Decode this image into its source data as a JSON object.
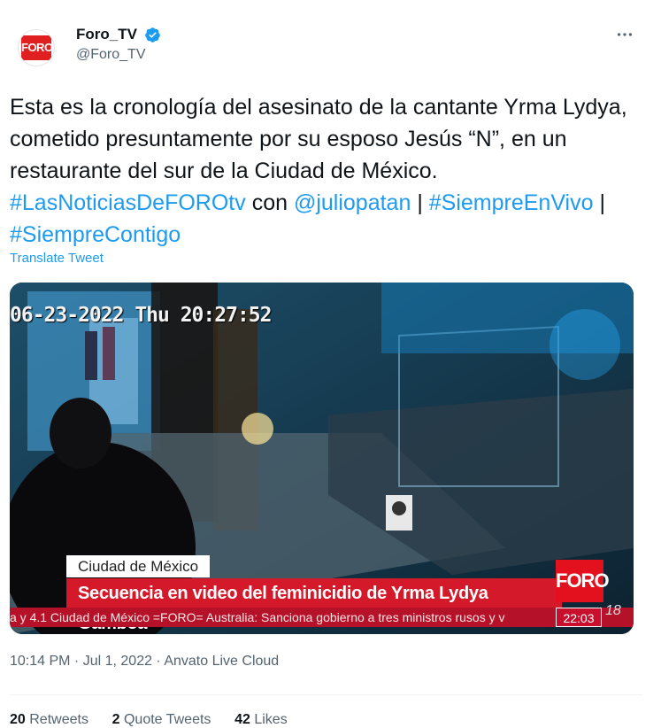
{
  "author": {
    "display_name": "Foro_TV",
    "handle": "@Foro_TV",
    "avatar_text": "FORO",
    "verified": true
  },
  "more_icon": "more-horizontal-icon",
  "tweet": {
    "text_plain_1": "Esta es la cronología del asesinato de la cantante Yrma Lydya, cometido presuntamente por su esposo Jesús “N”, en un restaurante del sur de la Ciudad de México. ",
    "hashtag_1": "#LasNoticiasDeFOROtv",
    "text_plain_2": " con ",
    "mention_1": "@juliopatan",
    "sep_1": " | ",
    "hashtag_2": "#SiempreEnVivo",
    "sep_2": " | ",
    "hashtag_3": "#SiempreContigo",
    "translate_label": "Translate Tweet"
  },
  "video": {
    "cctv_timestamp": "06-23-2022 Thu 20:27:52",
    "location_label": "Ciudad de México",
    "headline": "Secuencia en video del feminicidio de Yrma Lydya Gamboa",
    "ticker": "a y 4.1 Ciudad de México   =FORO=   Australia: Sanciona gobierno a tres ministros rusos y v",
    "channel_badge": "FORO",
    "clock": "22:03",
    "corner_text": "18"
  },
  "meta": {
    "time": "10:14 PM",
    "dot_1": " · ",
    "date": "Jul 1, 2022",
    "dot_2": " · ",
    "source": "Anvato Live Cloud"
  },
  "stats": {
    "retweets_count": "20",
    "retweets_label": "Retweets",
    "quotes_count": "2",
    "quotes_label": "Quote Tweets",
    "likes_count": "42",
    "likes_label": "Likes"
  },
  "colors": {
    "link": "#1d9bf0",
    "verified": "#1d9bf0",
    "brand_red": "#e3101e"
  }
}
